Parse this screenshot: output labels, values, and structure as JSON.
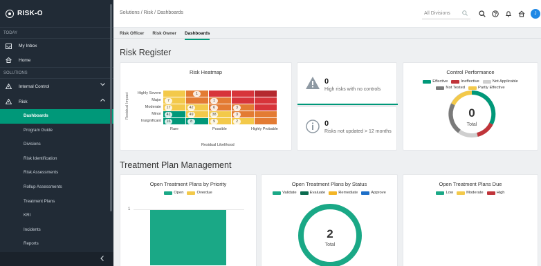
{
  "app": {
    "name": "RISK-O"
  },
  "sidebar": {
    "today_label": "TODAY",
    "inbox_label": "My Inbox",
    "home_label": "Home",
    "solutions_label": "SOLUTIONS",
    "internal_control_label": "Internal Control",
    "risk_label": "Risk",
    "sub_items": [
      "Dashboards",
      "Program Guide",
      "Divisions",
      "Risk Identification",
      "Risk Assessments",
      "Rollup Assessments",
      "Treatment Plans",
      "KRI",
      "Incidents",
      "Reports"
    ],
    "collapse_icon": "chevron-left-icon"
  },
  "topbar": {
    "breadcrumb": "Solutions / Risk / Dashboards",
    "division_placeholder": "All Divisions",
    "avatar_initial": "J"
  },
  "tabs": [
    "Risk Officer",
    "Risk Owner",
    "Dashboards"
  ],
  "risk_register": {
    "title": "Risk Register",
    "heatmap": {
      "title": "Risk Heatmap",
      "y_title": "Residual Impact",
      "x_title": "Residual Likelihood",
      "rows": [
        "Highly Severe",
        "Major",
        "Moderate",
        "Minor",
        "Insignificant"
      ],
      "x_ticks": [
        "Rare",
        "Possible",
        "Highly Probable"
      ],
      "badges": {
        "r0c1": "1",
        "r1c0": "7",
        "r1c2": "1",
        "r2c0": "17",
        "r2c1": "42",
        "r2c2": "6",
        "r2c3": "3",
        "r3c0": "41",
        "r3c1": "49",
        "r3c2": "38",
        "r3c3": "3",
        "r4c0": "16",
        "r4c1": "8",
        "r4c2": "9",
        "r4c3": "2"
      },
      "colors": {
        "green": "#009879",
        "yellow": "#f3c94a",
        "orange": "#e37b33",
        "red": "#d7343a",
        "darkred": "#b5292f"
      }
    },
    "kpi_no_controls": {
      "value": "0",
      "label": "High risks with no controls"
    },
    "kpi_not_updated": {
      "value": "0",
      "label": "Risks not updated > 12 months"
    },
    "control_performance": {
      "title": "Control Performance",
      "legend": [
        {
          "label": "Effective",
          "color": "#009879"
        },
        {
          "label": "Ineffective",
          "color": "#c0343a"
        },
        {
          "label": "Not Applicable",
          "color": "#cfcfcf"
        },
        {
          "label": "Not Tested",
          "color": "#7a7a7a"
        },
        {
          "label": "Partly Effective",
          "color": "#f3c94a"
        }
      ],
      "total_value": "0",
      "total_label": "Total"
    }
  },
  "treatment": {
    "title": "Treatment Plan Management",
    "by_priority": {
      "title": "Open Treatment Plans by Priority",
      "legend": [
        {
          "label": "Open",
          "color": "#1aa886"
        },
        {
          "label": "Overdue",
          "color": "#f3c94a"
        }
      ],
      "y_tick": "1"
    },
    "by_status": {
      "title": "Open Treatment Plans by Status",
      "legend": [
        {
          "label": "Validate",
          "color": "#1aa886"
        },
        {
          "label": "Evaluate",
          "color": "#0b6b4f"
        },
        {
          "label": "Remediate",
          "color": "#f3b526"
        },
        {
          "label": "Approve",
          "color": "#1e6fc8"
        }
      ],
      "total_value": "2",
      "total_label": "Total"
    },
    "due": {
      "title": "Open Treatment Plans Due",
      "legend": [
        {
          "label": "Low",
          "color": "#1aa886"
        },
        {
          "label": "Moderate",
          "color": "#f3c94a"
        },
        {
          "label": "High",
          "color": "#c0343a"
        }
      ]
    }
  }
}
